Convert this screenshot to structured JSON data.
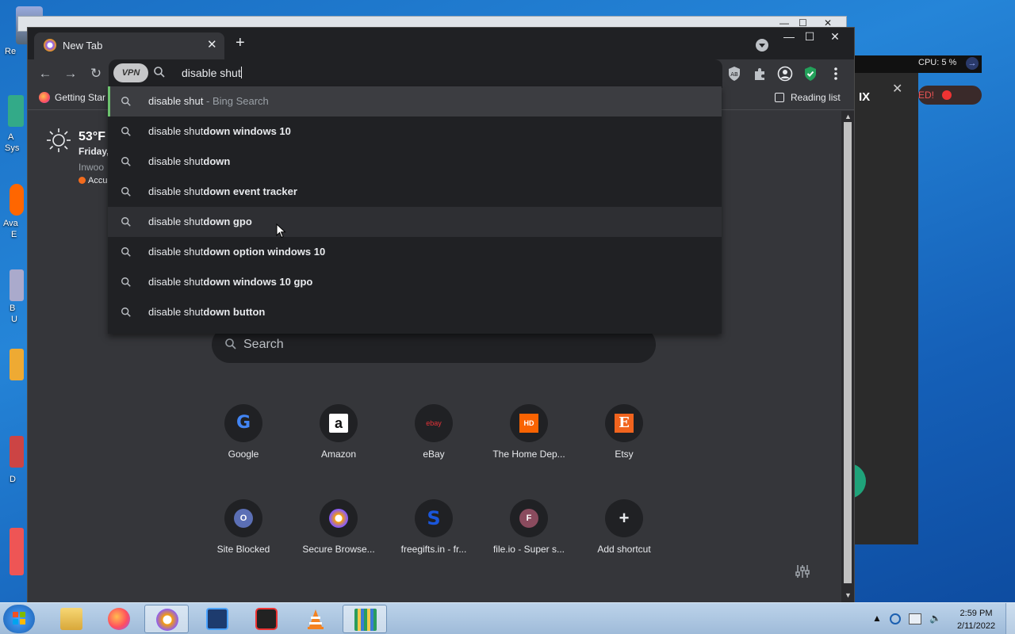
{
  "desktop": {
    "labels": [
      "Re",
      "A",
      "Sys",
      "Ava",
      "E",
      "B",
      "U",
      "D"
    ]
  },
  "background_app": {
    "cpu": "CPU: 5 %",
    "title_fragment": "IX",
    "status_fragment": "ED!"
  },
  "browser": {
    "tab_title": "New Tab",
    "omnibox_text": "disable shut",
    "vpn_label": "VPN",
    "bookmarks": {
      "getting_started": "Getting Star",
      "reading_list": "Reading list"
    },
    "weather": {
      "temp": "53°F",
      "day": "Friday,",
      "location": "Inwoo",
      "source": "Accu"
    },
    "search_placeholder": "Search",
    "suggestions": [
      {
        "typed": "disable shut",
        "completion": "",
        "suffix": " - Bing Search"
      },
      {
        "typed": "disable shut",
        "completion": "down windows 10",
        "suffix": ""
      },
      {
        "typed": "disable shut",
        "completion": "down",
        "suffix": ""
      },
      {
        "typed": "disable shut",
        "completion": "down event tracker",
        "suffix": ""
      },
      {
        "typed": "disable shut",
        "completion": "down gpo",
        "suffix": ""
      },
      {
        "typed": "disable shut",
        "completion": "down option windows 10",
        "suffix": ""
      },
      {
        "typed": "disable shut",
        "completion": "down windows 10 gpo",
        "suffix": ""
      },
      {
        "typed": "disable shut",
        "completion": "down button",
        "suffix": ""
      }
    ],
    "shortcuts": [
      {
        "label": "Google",
        "glyph": "G",
        "color": "#4285f4"
      },
      {
        "label": "Amazon",
        "glyph": "a",
        "color": "#111111"
      },
      {
        "label": "eBay",
        "glyph": "ebay",
        "color": "#e53238"
      },
      {
        "label": "The Home Dep...",
        "glyph": "HD",
        "color": "#f96302"
      },
      {
        "label": "Etsy",
        "glyph": "E",
        "color": "#f1641e"
      },
      {
        "label": "Site Blocked",
        "glyph": "O",
        "color": "#5b6fb5"
      },
      {
        "label": "Secure Browse...",
        "glyph": "▼",
        "color": "#f59e0b"
      },
      {
        "label": "freegifts.in - fr...",
        "glyph": "S",
        "color": "#1a56db"
      },
      {
        "label": "file.io - Super s...",
        "glyph": "F",
        "color": "#8a4b5e"
      },
      {
        "label": "Add shortcut",
        "glyph": "+",
        "color": "#e8eaed"
      }
    ]
  },
  "taskbar": {
    "time": "2:59 PM",
    "date": "2/11/2022"
  },
  "colors": {
    "accent_green": "#6cc26e",
    "chrome_dark": "#202124",
    "chrome_mid": "#35363a"
  }
}
